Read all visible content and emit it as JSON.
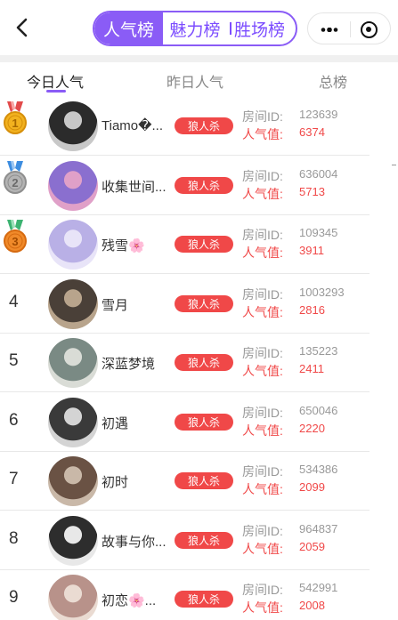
{
  "header": {
    "segments": [
      {
        "label": "人气榜",
        "active": true
      },
      {
        "label": "魅力榜",
        "active": false
      },
      {
        "label": "胜场榜",
        "active": false
      }
    ],
    "accent_color": "#8a5cf6"
  },
  "tabs": [
    {
      "label": "今日人气",
      "active": true
    },
    {
      "label": "昨日人气",
      "active": false
    },
    {
      "label": "总榜",
      "active": false
    }
  ],
  "labels": {
    "room": "房间ID:",
    "popularity": "人气值:"
  },
  "rows": [
    {
      "rank": "1",
      "medal": "gold",
      "name": "Tiamo�...",
      "tag": "狼人杀",
      "room_id": "123639",
      "popularity": "6374"
    },
    {
      "rank": "2",
      "medal": "silver",
      "name": "收集世间...",
      "tag": "狼人杀",
      "room_id": "636004",
      "popularity": "5713"
    },
    {
      "rank": "3",
      "medal": "bronze",
      "name": "残雪🌸",
      "tag": "狼人杀",
      "room_id": "109345",
      "popularity": "3911"
    },
    {
      "rank": "4",
      "medal": "",
      "name": "雪月",
      "tag": "狼人杀",
      "room_id": "1003293",
      "popularity": "2816"
    },
    {
      "rank": "5",
      "medal": "",
      "name": "深蓝梦境",
      "tag": "狼人杀",
      "room_id": "135223",
      "popularity": "2411"
    },
    {
      "rank": "6",
      "medal": "",
      "name": "初遇",
      "tag": "狼人杀",
      "room_id": "650046",
      "popularity": "2220"
    },
    {
      "rank": "7",
      "medal": "",
      "name": "初时",
      "tag": "狼人杀",
      "room_id": "534386",
      "popularity": "2099"
    },
    {
      "rank": "8",
      "medal": "",
      "name": "故事与你...",
      "tag": "狼人杀",
      "room_id": "964837",
      "popularity": "2059"
    },
    {
      "rank": "9",
      "medal": "",
      "name": "初恋🌸...",
      "tag": "狼人杀",
      "room_id": "542991",
      "popularity": "2008"
    }
  ]
}
